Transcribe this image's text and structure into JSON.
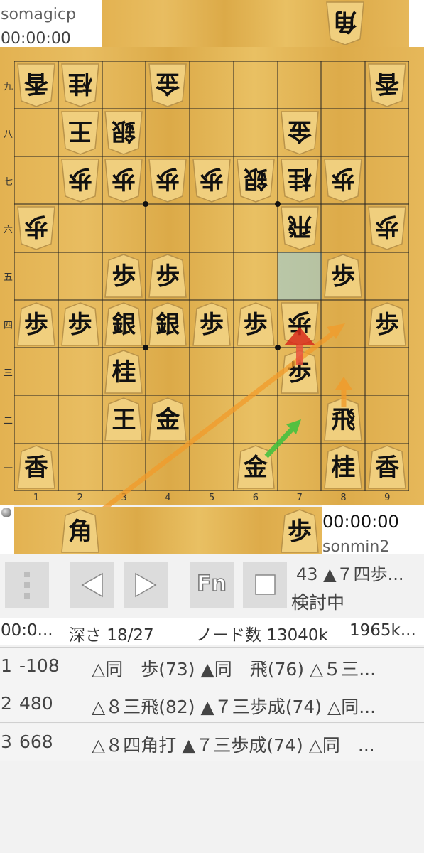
{
  "top_player": {
    "name": "somagicp",
    "clock": "00:00:00",
    "hand": [
      "角"
    ]
  },
  "bottom_player": {
    "name": "sonmin2",
    "clock": "00:00:00",
    "hand": [
      "角",
      "歩"
    ]
  },
  "board": {
    "row_labels": [
      "九",
      "八",
      "七",
      "六",
      "五",
      "四",
      "三",
      "二",
      "一"
    ],
    "col_labels": [
      "1",
      "2",
      "3",
      "4",
      "5",
      "6",
      "7",
      "8",
      "9"
    ],
    "pieces": [
      {
        "r": 0,
        "c": 0,
        "ch": "香",
        "flip": true
      },
      {
        "r": 0,
        "c": 1,
        "ch": "桂",
        "flip": true
      },
      {
        "r": 0,
        "c": 3,
        "ch": "金",
        "flip": true
      },
      {
        "r": 0,
        "c": 8,
        "ch": "香",
        "flip": true
      },
      {
        "r": 1,
        "c": 1,
        "ch": "王",
        "flip": true
      },
      {
        "r": 1,
        "c": 2,
        "ch": "銀",
        "flip": true
      },
      {
        "r": 1,
        "c": 6,
        "ch": "金",
        "flip": true
      },
      {
        "r": 2,
        "c": 1,
        "ch": "歩",
        "flip": true
      },
      {
        "r": 2,
        "c": 2,
        "ch": "歩",
        "flip": true
      },
      {
        "r": 2,
        "c": 3,
        "ch": "歩",
        "flip": true
      },
      {
        "r": 2,
        "c": 4,
        "ch": "歩",
        "flip": true
      },
      {
        "r": 2,
        "c": 5,
        "ch": "銀",
        "flip": true
      },
      {
        "r": 2,
        "c": 6,
        "ch": "桂",
        "flip": true
      },
      {
        "r": 2,
        "c": 7,
        "ch": "歩",
        "flip": true
      },
      {
        "r": 3,
        "c": 0,
        "ch": "歩",
        "flip": true
      },
      {
        "r": 3,
        "c": 6,
        "ch": "飛",
        "flip": true
      },
      {
        "r": 3,
        "c": 8,
        "ch": "歩",
        "flip": true
      },
      {
        "r": 4,
        "c": 2,
        "ch": "歩",
        "flip": false
      },
      {
        "r": 4,
        "c": 3,
        "ch": "歩",
        "flip": false
      },
      {
        "r": 4,
        "c": 7,
        "ch": "歩",
        "flip": false
      },
      {
        "r": 5,
        "c": 0,
        "ch": "歩",
        "flip": false
      },
      {
        "r": 5,
        "c": 1,
        "ch": "歩",
        "flip": false
      },
      {
        "r": 5,
        "c": 2,
        "ch": "銀",
        "flip": false
      },
      {
        "r": 5,
        "c": 3,
        "ch": "銀",
        "flip": false
      },
      {
        "r": 5,
        "c": 4,
        "ch": "歩",
        "flip": false
      },
      {
        "r": 5,
        "c": 5,
        "ch": "歩",
        "flip": false
      },
      {
        "r": 5,
        "c": 6,
        "ch": "歩",
        "flip": true
      },
      {
        "r": 5,
        "c": 8,
        "ch": "歩",
        "flip": false
      },
      {
        "r": 6,
        "c": 2,
        "ch": "桂",
        "flip": false
      },
      {
        "r": 6,
        "c": 6,
        "ch": "歩",
        "flip": false
      },
      {
        "r": 7,
        "c": 2,
        "ch": "王",
        "flip": false
      },
      {
        "r": 7,
        "c": 3,
        "ch": "金",
        "flip": false
      },
      {
        "r": 7,
        "c": 7,
        "ch": "飛",
        "flip": false
      },
      {
        "r": 8,
        "c": 0,
        "ch": "香",
        "flip": false
      },
      {
        "r": 8,
        "c": 5,
        "ch": "金",
        "flip": false
      },
      {
        "r": 8,
        "c": 7,
        "ch": "桂",
        "flip": false
      },
      {
        "r": 8,
        "c": 8,
        "ch": "香",
        "flip": false
      }
    ]
  },
  "toolbar": {
    "menu_icon": "vertical-dots-icon",
    "prev_icon": "triangle-left-icon",
    "next_icon": "triangle-right-icon",
    "fn_label": "Fn",
    "stop_icon": "square-icon"
  },
  "status": {
    "move": "43 ▲７四歩...",
    "mode": "検討中"
  },
  "stats": {
    "time": "00:0...",
    "depth": "深さ 18/27",
    "nodes": "ノード数 13040k",
    "nps": "1965k..."
  },
  "pv_lines": [
    {
      "index": "1",
      "score": "-108",
      "moves": "△同　歩(73) ▲同　飛(76) △５三..."
    },
    {
      "index": "2",
      "score": "480",
      "moves": "△８三飛(82) ▲７三歩成(74) △同..."
    },
    {
      "index": "3",
      "score": "668",
      "moves": "△８四角打 ▲７三歩成(74) △同　..."
    }
  ]
}
